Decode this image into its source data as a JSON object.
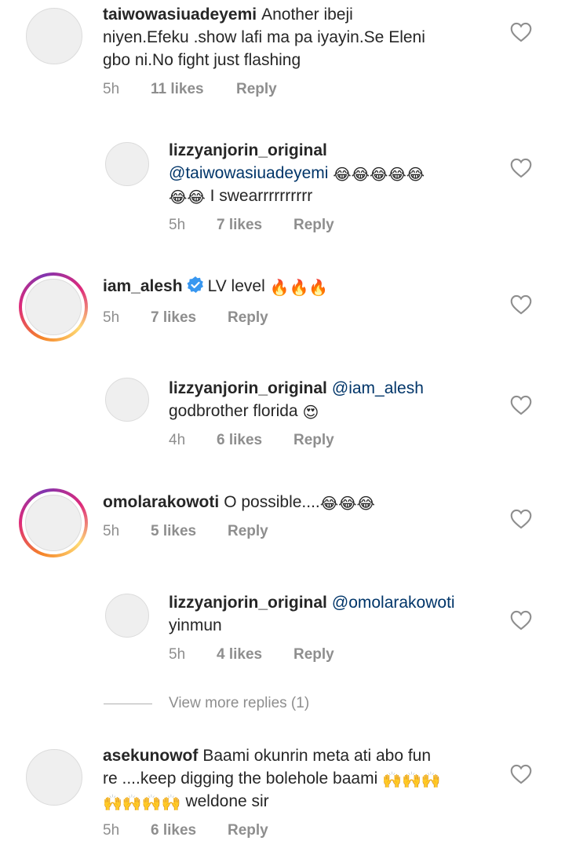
{
  "comments": [
    {
      "username": "taiwowasiuadeyemi",
      "lines": [
        "Another ibeji",
        "niyen.Efeku .show lafi ma pa iyayin.Se Eleni",
        "gbo ni.No fight  just flashing"
      ],
      "time": "5h",
      "likes": "11 likes",
      "reply": "Reply"
    },
    {
      "username": "lizzyanjorin_original",
      "mention": "@taiwowasiuadeyemi",
      "line2": "I swearrrrrrrrrr",
      "time": "5h",
      "likes": "7 likes",
      "reply": "Reply"
    },
    {
      "username": "iam_alesh",
      "text": "LV level",
      "time": "5h",
      "likes": "7 likes",
      "reply": "Reply"
    },
    {
      "username": "lizzyanjorin_original",
      "mention": "@iam_alesh",
      "line2": "godbrother florida",
      "time": "4h",
      "likes": "6 likes",
      "reply": "Reply"
    },
    {
      "username": "omolarakowoti",
      "text": "O possible....",
      "time": "5h",
      "likes": "5 likes",
      "reply": "Reply"
    },
    {
      "username": "lizzyanjorin_original",
      "mention": "@omolarakowoti",
      "line2": "yinmun",
      "time": "5h",
      "likes": "4 likes",
      "reply": "Reply"
    },
    {
      "username": "asekunowof",
      "lines": [
        "Baami okunrin meta ati abo fun",
        "re ....keep digging the bolehole baami",
        "weldone sir"
      ],
      "time": "5h",
      "likes": "6 likes",
      "reply": "Reply"
    }
  ],
  "view_more": "View more replies (1)",
  "icons": {
    "heart": "heart-outline-icon",
    "laugh": "😂",
    "fire": "🔥",
    "heart_eyes": "😍",
    "raised_hands": "🙌",
    "verified": "verified-badge-icon"
  },
  "colors": {
    "mention": "#003569",
    "meta": "#8e8e8e",
    "verified": "#3897f0"
  }
}
